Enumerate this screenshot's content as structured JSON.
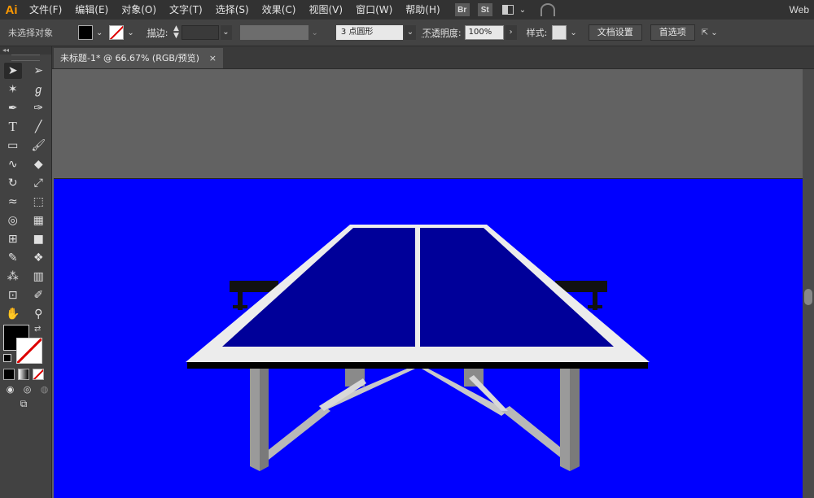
{
  "app": {
    "logo": "Ai",
    "workspace": "Web"
  },
  "menu": [
    "文件(F)",
    "编辑(E)",
    "对象(O)",
    "文字(T)",
    "选择(S)",
    "效果(C)",
    "视图(V)",
    "窗口(W)",
    "帮助(H)"
  ],
  "bridges": [
    "Br",
    "St"
  ],
  "control": {
    "selection_state": "未选择对象",
    "stroke_label": "描边",
    "brush": "3 点圆形",
    "opacity_label": "不透明度",
    "opacity_value": "100%",
    "style_label": "样式",
    "doc_setup": "文档设置",
    "preferences": "首选项"
  },
  "document": {
    "tab_title": "未标题-1* @ 66.67% (RGB/预览)",
    "close": "×"
  },
  "colors": {
    "artboard": "#0000ff",
    "table_top": "#000099",
    "table_border": "#ececec",
    "pasteboard": "#626262"
  },
  "tools": [
    [
      "selection-tool",
      "direct-selection-tool"
    ],
    [
      "magic-wand-tool",
      "lasso-tool"
    ],
    [
      "pen-tool",
      "curvature-tool"
    ],
    [
      "type-tool",
      "line-segment-tool"
    ],
    [
      "rectangle-tool",
      "paintbrush-tool"
    ],
    [
      "shaper-tool",
      "eraser-tool"
    ],
    [
      "rotate-tool",
      "scale-tool"
    ],
    [
      "width-tool",
      "free-transform-tool"
    ],
    [
      "shape-builder-tool",
      "perspective-grid-tool"
    ],
    [
      "mesh-tool",
      "gradient-tool"
    ],
    [
      "eyedropper-tool",
      "blend-tool"
    ],
    [
      "symbol-sprayer-tool",
      "column-graph-tool"
    ],
    [
      "artboard-tool",
      "slice-tool"
    ],
    [
      "hand-tool",
      "zoom-tool"
    ]
  ]
}
